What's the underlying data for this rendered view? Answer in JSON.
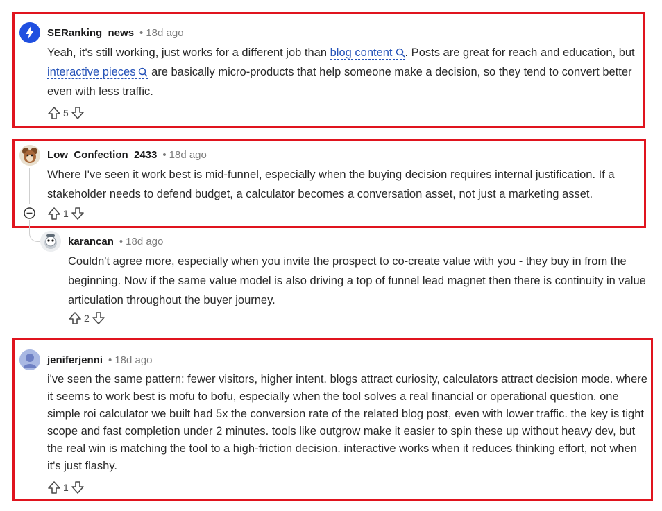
{
  "comments": [
    {
      "author": "SERanking_news",
      "age": "18d ago",
      "text_1": "Yeah, it's still working, just works for a different job than ",
      "link_1": "blog content",
      "text_2": ". Posts are great for reach and education, but ",
      "link_2": "interactive pieces",
      "text_3": " are basically micro-products that help someone make a decision, so they tend to convert better even with less traffic.",
      "score": "5",
      "avatar_icon": "lightning-bolt-icon"
    },
    {
      "author": "Low_Confection_2433",
      "age": "18d ago",
      "text": "Where I've seen it work best is mid-funnel, especially when the buying decision requires internal justification. If a stakeholder needs to defend budget, a calculator becomes a conversation asset, not just a marketing asset.",
      "score": "1",
      "avatar_icon": "snoo-avatar-icon"
    },
    {
      "author": "karancan",
      "age": "18d ago",
      "text": "Couldn't agree more, especially when you invite the prospect to co-create value with you - they buy in from the beginning. Now if the same value model is also driving a top of funnel lead magnet then there is continuity in value articulation throughout the buyer journey.",
      "score": "2",
      "avatar_icon": "snoo-avatar-icon"
    },
    {
      "author": "jeniferjenni",
      "age": "18d ago",
      "text": "i've seen the same pattern: fewer visitors, higher intent. blogs attract curiosity, calculators attract decision mode. where it seems to work best is mofu to bofu, especially when the tool solves a real financial or operational question. one simple roi calculator we built had 5x the conversion rate of the related blog post, even with lower traffic. the key is tight scope and fast completion under 2 minutes. tools like outgrow make it easier to spin these up without heavy dev, but the real win is matching the tool to a high-friction decision. interactive works when it reduces thinking effort, not when it's just flashy.",
      "score": "1",
      "avatar_icon": "default-snoo-icon"
    }
  ],
  "separator": "•",
  "highlight_color": "#e0141e",
  "link_color": "#2452b8"
}
